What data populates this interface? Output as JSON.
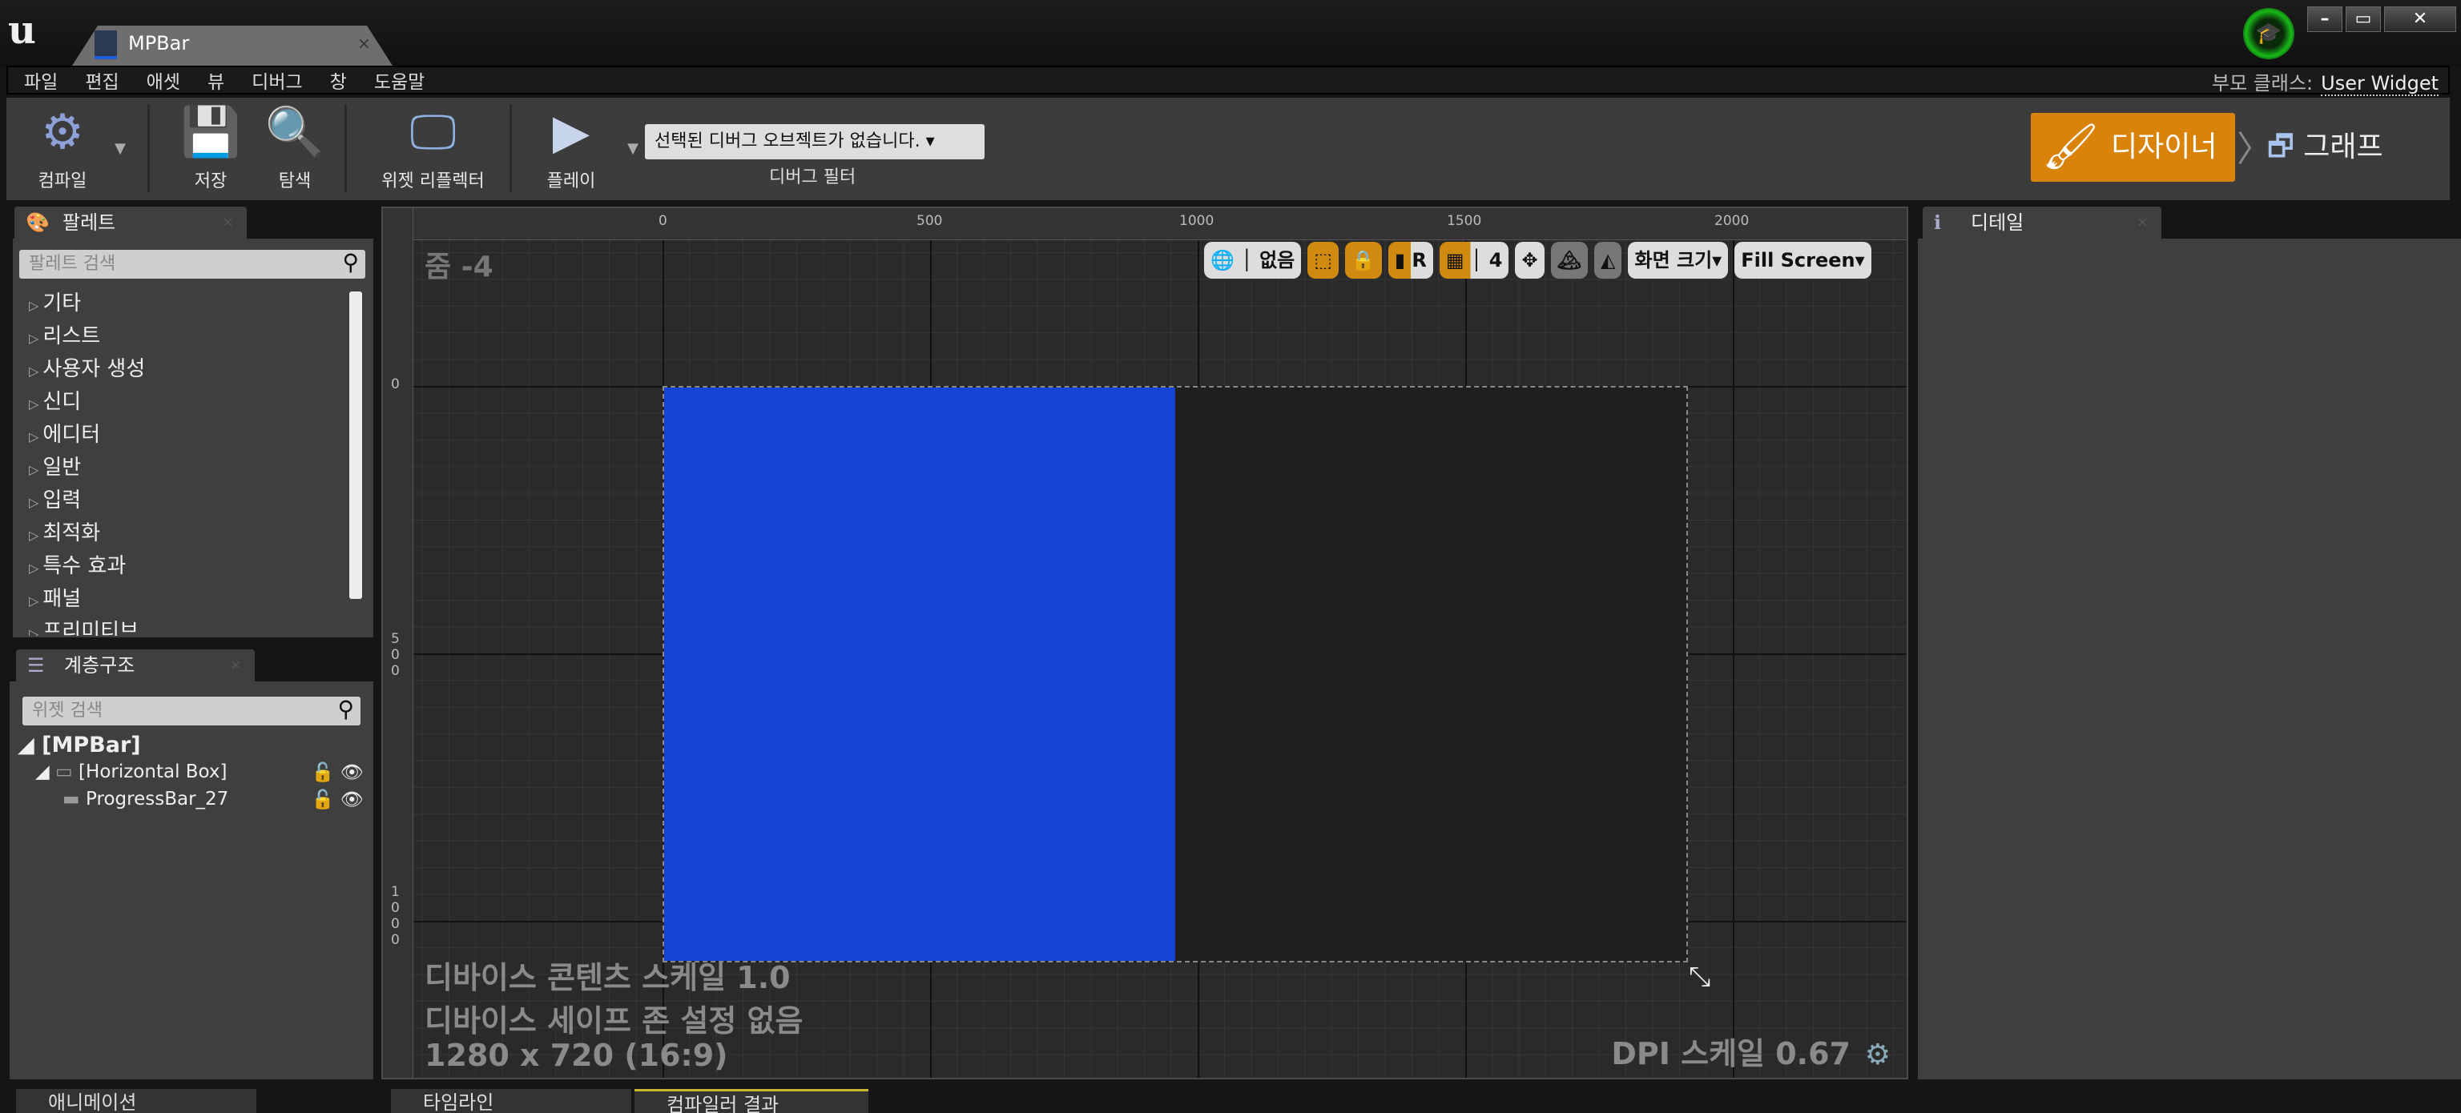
{
  "window": {
    "tab_title": "MPBar",
    "parent_class_label": "부모 클래스:",
    "parent_class": "User Widget"
  },
  "menu": [
    "파일",
    "편집",
    "애셋",
    "뷰",
    "디버그",
    "창",
    "도움말"
  ],
  "toolbar": {
    "compile": "컴파일",
    "save": "저장",
    "browse": "탐색",
    "widget_reflector": "위젯 리플렉터",
    "play": "플레이",
    "debug_object": "선택된 디버그 오브젝트가 없습니다.",
    "debug_filter": "디버그 필터",
    "designer": "디자이너",
    "graph": "그래프"
  },
  "palette": {
    "title": "팔레트",
    "search_placeholder": "팔레트 검색",
    "categories": [
      "기타",
      "리스트",
      "사용자 생성",
      "신디",
      "에디터",
      "일반",
      "입력",
      "최적화",
      "특수 효과",
      "패널",
      "프리미티브"
    ]
  },
  "hierarchy": {
    "title": "계층구조",
    "search_placeholder": "위젯 검색",
    "root": "[MPBar]",
    "items": [
      {
        "label": "[Horizontal Box]"
      },
      {
        "label": "ProgressBar_27"
      }
    ]
  },
  "canvas": {
    "zoom": "줌 -4",
    "ruler_top": [
      "0",
      "500",
      "1000",
      "1500",
      "2000"
    ],
    "ruler_left": [
      "0",
      "500",
      "1000"
    ],
    "localization": "없음",
    "grid_snap": "4",
    "screen_size": "화면 크기",
    "fill_mode": "Fill Screen",
    "content_scale": "디바이스 콘텐츠 스케일 1.0",
    "safe_zone": "디바이스 세이프 존 설정 없음",
    "resolution": "1280 x 720 (16:9)",
    "dpi_scale": "DPI 스케일 0.67",
    "progress_fill_percent": 50,
    "bar_color": "#1645d4",
    "accent": "#d9830b"
  },
  "details": {
    "title": "디테일"
  },
  "bottom_tabs": [
    "애니메이션",
    "타임라인",
    "컴파일러 결과"
  ]
}
